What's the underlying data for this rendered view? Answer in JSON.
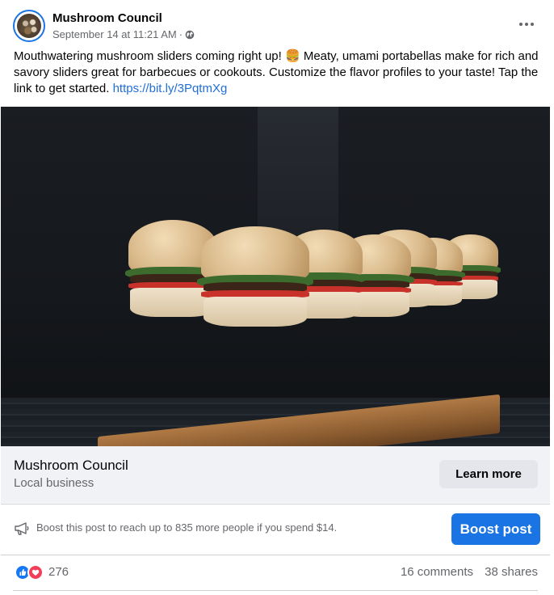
{
  "post": {
    "author": "Mushroom Council",
    "timestamp": "September 14 at 11:21 AM",
    "separator": "·",
    "audience_icon": "globe-icon",
    "text_before_emoji": "Mouthwatering mushroom sliders coming right up! ",
    "emoji": "🍔",
    "text_after_emoji": " Meaty, umami portabellas make for rich and savory sliders great for barbecues or cookouts. Customize the flavor profiles to your taste! Tap the link to get started. ",
    "link": "https://bit.ly/3PqtmXg"
  },
  "link_preview": {
    "title": "Mushroom Council",
    "subtitle": "Local business",
    "cta_label": "Learn more"
  },
  "boost": {
    "text": "Boost this post to reach up to 835 more people if you spend $14.",
    "button_label": "Boost post"
  },
  "engagement": {
    "reaction_count": "276",
    "comments": "16 comments",
    "shares": "38 shares"
  },
  "colors": {
    "accent": "#1b74e4",
    "link": "#216fdb",
    "like": "#1877f2",
    "love": "#f33e58"
  }
}
